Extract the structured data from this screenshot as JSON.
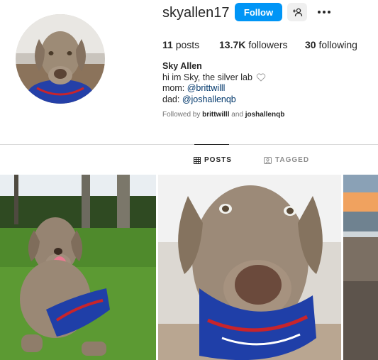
{
  "profile": {
    "username": "skyallen17",
    "follow_label": "Follow",
    "stats": {
      "posts_count": "11",
      "posts_label": "posts",
      "followers_count": "13.7K",
      "followers_label": "followers",
      "following_count": "30",
      "following_label": "following"
    },
    "bio": {
      "name": "Sky Allen",
      "line1": "hi im Sky, the silver lab",
      "mom_prefix": "mom: ",
      "mom_handle": "@brittwilll",
      "dad_prefix": "dad: ",
      "dad_handle": "@joshallenqb"
    },
    "followed_by": {
      "prefix": "Followed by ",
      "user1": "brittwilll",
      "and": " and ",
      "user2": "joshallenqb"
    }
  },
  "tabs": [
    {
      "label": "POSTS",
      "icon": "grid-icon",
      "active": true
    },
    {
      "label": "TAGGED",
      "icon": "tagged-icon",
      "active": false
    }
  ],
  "colors": {
    "accent": "#0095f6",
    "link": "#00376b",
    "bandana": "#1f3fa8"
  }
}
